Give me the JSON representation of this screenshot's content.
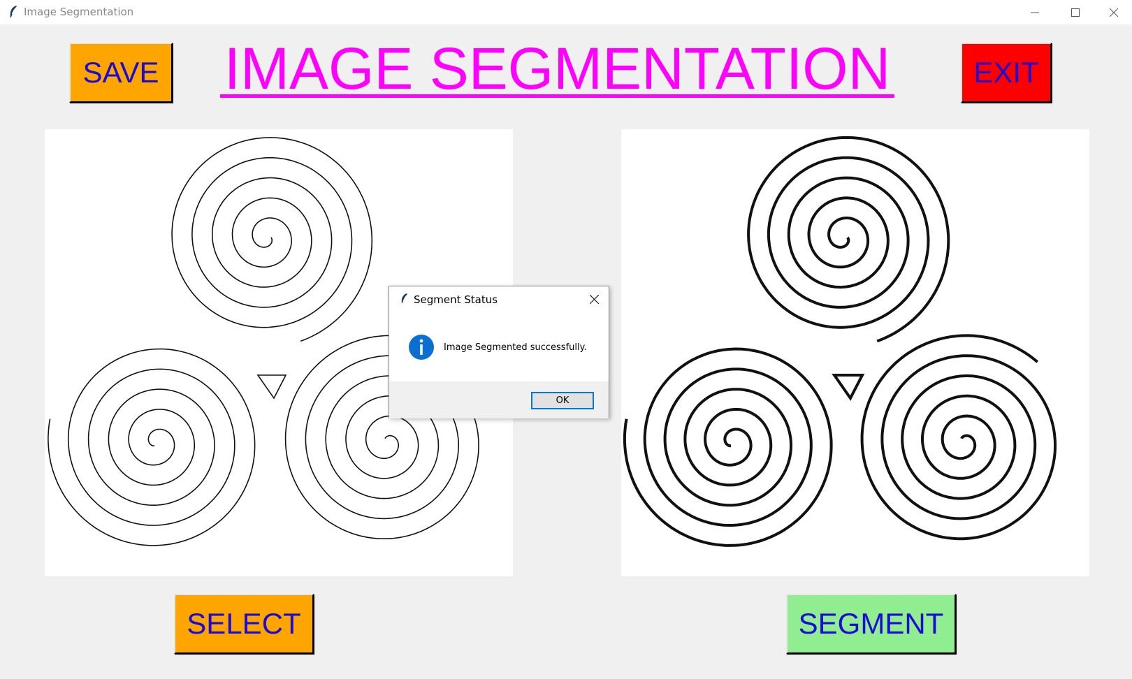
{
  "window": {
    "title": "Image Segmentation"
  },
  "header": {
    "title": "IMAGE SEGMENTATION"
  },
  "buttons": {
    "save": "SAVE",
    "exit": "EXIT",
    "select": "SELECT",
    "segment": "SEGMENT"
  },
  "colors": {
    "save_bg": "#ffa500",
    "exit_bg": "#ff0000",
    "select_bg": "#ffa500",
    "segment_bg": "#90ee90",
    "button_text": "#1b0bd6",
    "title": "#ff00ff"
  },
  "images": {
    "original": "triskelion-spiral-thin",
    "segmented": "triskelion-spiral-thick"
  },
  "dialog": {
    "title": "Segment Status",
    "message": "Image Segmented successfully.",
    "ok_label": "OK",
    "icon": "info-icon"
  }
}
